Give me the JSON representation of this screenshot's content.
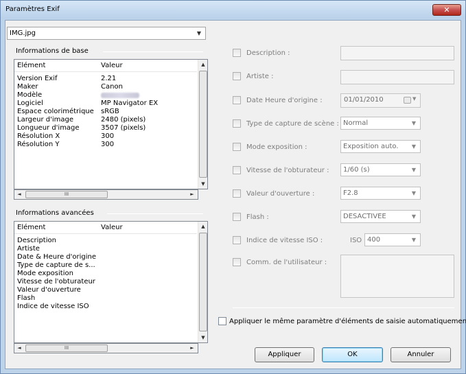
{
  "window": {
    "title": "Paramètres Exif",
    "close_glyph": "✕"
  },
  "file_select": {
    "value": "IMG.jpg"
  },
  "basic_info": {
    "group_label": "Informations de base",
    "columns": [
      "Elément",
      "Valeur"
    ],
    "rows": [
      {
        "element": "Version Exif",
        "value": "2.21"
      },
      {
        "element": "Maker",
        "value": "Canon"
      },
      {
        "element": "Modèle",
        "value": ""
      },
      {
        "element": "Logiciel",
        "value": "MP Navigator EX"
      },
      {
        "element": "Espace colorimétrique",
        "value": "sRGB"
      },
      {
        "element": "Largeur d'image",
        "value": "2480 (pixels)"
      },
      {
        "element": "Longueur d'image",
        "value": "3507 (pixels)"
      },
      {
        "element": "Résolution X",
        "value": "300"
      },
      {
        "element": "Résolution Y",
        "value": "300"
      }
    ]
  },
  "advanced_info": {
    "group_label": "Informations avancées",
    "columns": [
      "Elément",
      "Valeur"
    ],
    "rows": [
      {
        "element": "Description",
        "value": ""
      },
      {
        "element": "Artiste",
        "value": ""
      },
      {
        "element": "Date & Heure d'origine",
        "value": ""
      },
      {
        "element": "Type de capture de s...",
        "value": ""
      },
      {
        "element": "Mode exposition",
        "value": ""
      },
      {
        "element": "Vitesse de l'obturateur",
        "value": ""
      },
      {
        "element": "Valeur d'ouverture",
        "value": ""
      },
      {
        "element": "Flash",
        "value": ""
      },
      {
        "element": "Indice de vitesse ISO",
        "value": ""
      }
    ]
  },
  "scroll_glyphs": {
    "up": "▲",
    "down": "▼",
    "left": "◄",
    "right": "►",
    "grip": "≡",
    "hgrip": "III"
  },
  "fields": {
    "description": {
      "label": "Description :",
      "value": ""
    },
    "artist": {
      "label": "Artiste :",
      "value": ""
    },
    "datetime": {
      "label": "Date  Heure d'origine :",
      "value": "01/01/2010"
    },
    "scene_type": {
      "label": "Type de capture de scène :",
      "value": "Normal"
    },
    "exposure_mode": {
      "label": "Mode exposition :",
      "value": "Exposition auto."
    },
    "shutter_speed": {
      "label": "Vitesse de l'obturateur :",
      "value": "1/60 (s)"
    },
    "aperture": {
      "label": "Valeur d'ouverture :",
      "value": "F2.8"
    },
    "flash": {
      "label": "Flash :",
      "value": "DESACTIVEE"
    },
    "iso": {
      "label": "Indice de vitesse ISO :",
      "prefix": "ISO",
      "value": "400"
    },
    "user_comment": {
      "label": "Comm. de l'utilisateur :",
      "value": ""
    }
  },
  "apply_same": {
    "label": "Appliquer le même paramètre d'éléments de saisie automatiquement",
    "checked": false
  },
  "buttons": {
    "apply": "Appliquer",
    "ok": "OK",
    "cancel": "Annuler"
  },
  "icons": {
    "dropdown": "▼",
    "calendar": "calendar-icon"
  }
}
